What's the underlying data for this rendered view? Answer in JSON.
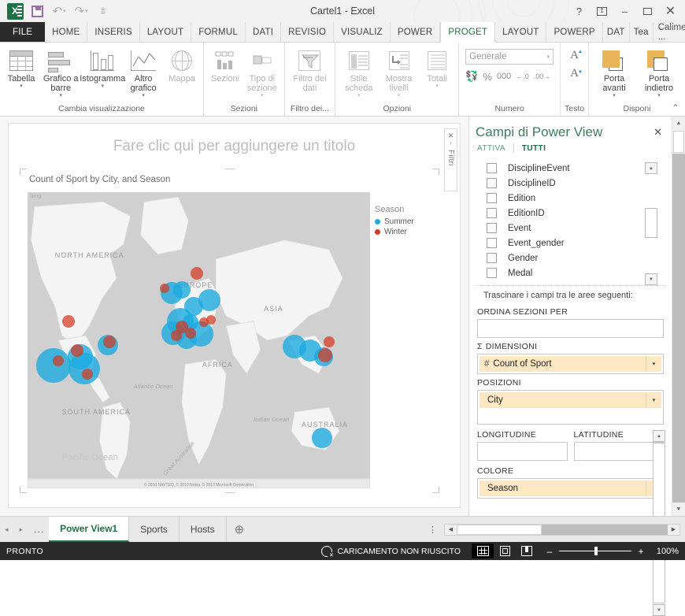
{
  "titlebar": {
    "doc_title": "Cartel1 - Excel",
    "qat": [
      {
        "name": "excel-logo",
        "label": "X"
      },
      {
        "name": "save-icon",
        "label": "Salva"
      },
      {
        "name": "undo-icon",
        "label": "Annulla"
      },
      {
        "name": "redo-icon",
        "label": "Ripeti"
      },
      {
        "name": "customize-qat-icon",
        "label": "Personalizza barra di accesso rapido"
      }
    ],
    "help": "?",
    "ribbon_display": "Opzioni visualizzazione barra multifunzione",
    "minimize": "–",
    "restore": "❑",
    "close": "✕"
  },
  "tabs": [
    {
      "label": "FILE",
      "state": "file"
    },
    {
      "label": "HOME",
      "state": "normal"
    },
    {
      "label": "INSERIS",
      "state": "normal"
    },
    {
      "label": "LAYOUT",
      "state": "normal"
    },
    {
      "label": "FORMUL",
      "state": "normal"
    },
    {
      "label": "DATI",
      "state": "normal"
    },
    {
      "label": "REVISIO",
      "state": "normal"
    },
    {
      "label": "VISUALIZ",
      "state": "normal"
    },
    {
      "label": "POWER",
      "state": "normal"
    },
    {
      "label": "PROGET",
      "state": "active"
    },
    {
      "label": "LAYOUT",
      "state": "normal"
    },
    {
      "label": "POWERP",
      "state": "normal"
    },
    {
      "label": "DAT",
      "state": "normal"
    },
    {
      "label": "Tea",
      "state": "normal"
    }
  ],
  "account": {
    "name": "Calimero ...",
    "caret": "▾"
  },
  "ribbon": {
    "groups": [
      {
        "label": "Cambia visualizzazione",
        "buttons": [
          {
            "label": "Tabella",
            "icon": "table-icon",
            "caret": "▾",
            "disabled": false
          },
          {
            "label": "Grafico a barre",
            "icon": "bar-chart-icon",
            "caret": "▾",
            "disabled": false
          },
          {
            "label": "Istogramma",
            "icon": "column-chart-icon",
            "caret": "▾",
            "disabled": false
          },
          {
            "label": "Altro grafico",
            "icon": "other-chart-icon",
            "caret": "▾",
            "disabled": false
          },
          {
            "label": "Mappa",
            "icon": "map-globe-icon",
            "caret": "",
            "disabled": true
          }
        ]
      },
      {
        "label": "Sezioni",
        "buttons": [
          {
            "label": "Sezioni",
            "icon": "tiles-icon",
            "caret": "",
            "disabled": true
          },
          {
            "label": "Tipo di sezione",
            "icon": "tile-type-icon",
            "caret": "▾",
            "disabled": true
          }
        ]
      },
      {
        "label": "Filtro dei...",
        "buttons": [
          {
            "label": "Filtro dei dati",
            "icon": "slicer-icon",
            "caret": "",
            "disabled": true
          }
        ]
      },
      {
        "label": "Opzioni",
        "buttons": [
          {
            "label": "Stile scheda",
            "icon": "card-style-icon",
            "caret": "▾",
            "disabled": true
          },
          {
            "label": "Mostra livelli",
            "icon": "show-levels-icon",
            "caret": "▾",
            "disabled": true
          },
          {
            "label": "Totali",
            "icon": "totals-icon",
            "caret": "▾",
            "disabled": true
          }
        ]
      },
      {
        "label": "Numero",
        "format_value": "Generale",
        "format_caret": "▾",
        "buttons": [
          {
            "label": "€",
            "icon": "currency-icon"
          },
          {
            "label": "%",
            "icon": "percent-icon"
          },
          {
            "label": "000",
            "icon": "thousands-icon"
          },
          {
            "label": "←.0",
            "icon": "increase-decimal-icon"
          },
          {
            "label": ".00→",
            "icon": "decrease-decimal-icon"
          }
        ]
      },
      {
        "label": "Testo",
        "buttons": [
          {
            "label": "A",
            "icon": "increase-font-size-icon"
          },
          {
            "label": "A",
            "icon": "decrease-font-size-icon"
          }
        ]
      },
      {
        "label": "Disponi",
        "buttons": [
          {
            "label": "Porta avanti",
            "icon": "bring-forward-icon",
            "caret": "▾",
            "disabled": false
          },
          {
            "label": "Porta indietro",
            "icon": "send-backward-icon",
            "caret": "▾",
            "disabled": false
          }
        ]
      }
    ],
    "collapse": "⌃"
  },
  "canvas": {
    "title_placeholder": "Fare clic qui per aggiungere un titolo",
    "viz_title": "Count of Sport by City, and Season",
    "bing_watermark": "bing",
    "attribution": "© 2010 NAVTEQ, © 2010 Nokia, © 2013 Microsoft Corporation",
    "filter_tab": {
      "close": "✕",
      "expand": "›",
      "label": "Filtri"
    }
  },
  "chart_data": {
    "type": "scatter",
    "title": "Count of Sport by City, and Season",
    "map_labels": [
      {
        "text": "NORTH AMERICA",
        "x": 10,
        "y": 24,
        "kind": "continent"
      },
      {
        "text": "SOUTH AMERICA",
        "x": 14,
        "y": 72,
        "kind": "continent"
      },
      {
        "text": "EUROPE",
        "x": 48,
        "y": 32,
        "kind": "continent"
      },
      {
        "text": "AFRICA",
        "x": 54,
        "y": 58,
        "kind": "continent"
      },
      {
        "text": "ASIA",
        "x": 72,
        "y": 39,
        "kind": "continent"
      },
      {
        "text": "AUSTRALIA",
        "x": 82,
        "y": 79,
        "kind": "continent"
      },
      {
        "text": "Atlantic Ocean",
        "x": 35,
        "y": 64,
        "kind": "ocean"
      },
      {
        "text": "Indian Ocean",
        "x": 69,
        "y": 76,
        "kind": "ocean"
      },
      {
        "text": "Pacific Ocean",
        "x": 13,
        "y": 88,
        "kind": "ocean"
      },
      {
        "text": "Great Australian",
        "x": 42,
        "y": 90,
        "kind": "ocean"
      }
    ],
    "legend": {
      "title": "Season",
      "position": "right",
      "entries": [
        {
          "label": "Summer",
          "color": "#1caade"
        },
        {
          "label": "Winter",
          "color": "#d63820"
        }
      ]
    },
    "series": [
      {
        "name": "Summer",
        "color": "#1caade",
        "points": [
          {
            "x": 7.5,
            "y": 58.5,
            "r": 22
          },
          {
            "x": 15.5,
            "y": 55.5,
            "r": 16
          },
          {
            "x": 16.5,
            "y": 59.5,
            "r": 20
          },
          {
            "x": 23.5,
            "y": 51.5,
            "r": 13
          },
          {
            "x": 42.0,
            "y": 34.0,
            "r": 14
          },
          {
            "x": 45.0,
            "y": 33.0,
            "r": 11
          },
          {
            "x": 48.5,
            "y": 38.5,
            "r": 12
          },
          {
            "x": 44.5,
            "y": 43.5,
            "r": 17
          },
          {
            "x": 42.5,
            "y": 47.5,
            "r": 15
          },
          {
            "x": 46.5,
            "y": 49.5,
            "r": 13
          },
          {
            "x": 50.5,
            "y": 48.0,
            "r": 16
          },
          {
            "x": 53.0,
            "y": 36.5,
            "r": 14
          },
          {
            "x": 47.5,
            "y": 44.0,
            "r": 10
          },
          {
            "x": 78.0,
            "y": 52.0,
            "r": 15
          },
          {
            "x": 82.5,
            "y": 53.5,
            "r": 14
          },
          {
            "x": 86.5,
            "y": 55.5,
            "r": 12
          },
          {
            "x": 86.0,
            "y": 83.0,
            "r": 13
          }
        ]
      },
      {
        "name": "Winter",
        "color": "#d63820",
        "points": [
          {
            "x": 12.0,
            "y": 43.5,
            "r": 8
          },
          {
            "x": 9.0,
            "y": 57.0,
            "r": 7
          },
          {
            "x": 14.5,
            "y": 53.5,
            "r": 8
          },
          {
            "x": 17.5,
            "y": 61.5,
            "r": 7
          },
          {
            "x": 24.0,
            "y": 50.5,
            "r": 8
          },
          {
            "x": 49.5,
            "y": 27.5,
            "r": 8
          },
          {
            "x": 40.0,
            "y": 32.5,
            "r": 6
          },
          {
            "x": 45.0,
            "y": 45.5,
            "r": 8
          },
          {
            "x": 47.5,
            "y": 47.5,
            "r": 7
          },
          {
            "x": 43.5,
            "y": 48.5,
            "r": 7
          },
          {
            "x": 51.5,
            "y": 44.0,
            "r": 6
          },
          {
            "x": 53.5,
            "y": 43.0,
            "r": 6
          },
          {
            "x": 88.0,
            "y": 50.5,
            "r": 7
          },
          {
            "x": 87.0,
            "y": 55.0,
            "r": 9
          }
        ]
      }
    ]
  },
  "fields_pane": {
    "title": "Campi di Power View",
    "close": "✕",
    "tabs": [
      {
        "label": "ATTIVA",
        "selected": false
      },
      {
        "label": "TUTTI",
        "selected": true
      }
    ],
    "fields": [
      {
        "label": "DisciplineEvent",
        "checked": false
      },
      {
        "label": "DisciplineID",
        "checked": false
      },
      {
        "label": "Edition",
        "checked": false
      },
      {
        "label": "EditionID",
        "checked": false
      },
      {
        "label": "Event",
        "checked": false
      },
      {
        "label": "Event_gender",
        "checked": false
      },
      {
        "label": "Gender",
        "checked": false
      },
      {
        "label": "Medal",
        "checked": false
      }
    ],
    "drag_hint": "Trascinare i campi tra le aree seguenti:",
    "zones": [
      {
        "label": "ORDINA SEZIONI PER",
        "sigma": false,
        "items": [],
        "tall": false
      },
      {
        "label": "DIMENSIONI",
        "sigma": true,
        "items": [
          {
            "label": "Count of Sport",
            "prefix": "#",
            "caret": "▾"
          }
        ],
        "tall": false
      },
      {
        "label": "POSIZIONI",
        "sigma": false,
        "items": [
          {
            "label": "City",
            "prefix": "",
            "caret": "▾"
          }
        ],
        "tall": true
      },
      {
        "label": "COLORE",
        "sigma": false,
        "items": [
          {
            "label": "Season",
            "prefix": "",
            "caret": "▾"
          }
        ],
        "tall": false
      }
    ],
    "lonlat": [
      {
        "label": "LONGITUDINE",
        "value": ""
      },
      {
        "label": "LATITUDINE",
        "value": ""
      }
    ],
    "sigma": "Σ"
  },
  "sheetbar": {
    "nav_prev": "◂",
    "nav_next": "▸",
    "nav_more": "...",
    "sheets": [
      {
        "label": "Power View1",
        "active": true
      },
      {
        "label": "Sports",
        "active": false
      },
      {
        "label": "Hosts",
        "active": false
      }
    ],
    "add_sheet": "⊕",
    "grip": "⋮"
  },
  "statusbar": {
    "ready": "PRONTO",
    "load_status": "CARICAMENTO NON RIUSCITO",
    "views": [
      {
        "name": "normal-view-icon",
        "selected": true
      },
      {
        "name": "page-layout-view-icon",
        "selected": false
      },
      {
        "name": "page-break-view-icon",
        "selected": false
      }
    ],
    "zoom_out": "–",
    "zoom_in": "+",
    "zoom_level": "100%"
  }
}
